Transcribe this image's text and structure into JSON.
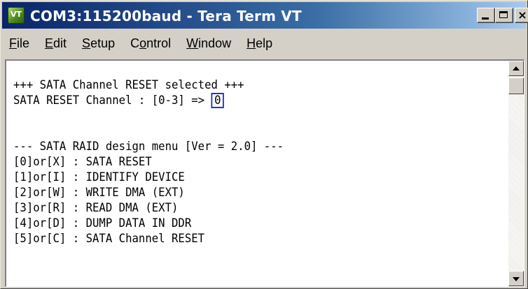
{
  "window": {
    "title": "COM3:115200baud - Tera Term VT",
    "app_icon_label": "VT",
    "icons": {
      "app": "tera-term-icon",
      "minimize": "minimize-icon",
      "maximize": "maximize-icon",
      "close": "close-icon"
    },
    "close_glyph": "×"
  },
  "menu": [
    {
      "mnemonic": "F",
      "rest": "ile"
    },
    {
      "mnemonic": "E",
      "rest": "dit"
    },
    {
      "mnemonic": "S",
      "rest": "etup"
    },
    {
      "prefix": "C",
      "mnemonic": "o",
      "rest": "ntrol"
    },
    {
      "mnemonic": "W",
      "rest": "indow"
    },
    {
      "mnemonic": "H",
      "rest": "elp"
    }
  ],
  "terminal": {
    "line_selected": "+++ SATA Channel RESET selected +++",
    "prompt_text": "SATA RESET Channel : [0-3] => ",
    "prompt_input": "0",
    "menu_header": "--- SATA RAID design menu [Ver = 2.0] ---",
    "options": [
      "[0]or[X] : SATA RESET",
      "[1]or[I] : IDENTIFY DEVICE",
      "[2]or[W] : WRITE DMA (EXT)",
      "[3]or[R] : READ DMA (EXT)",
      "[4]or[D] : DUMP DATA IN DDR",
      "[5]or[C] : SATA Channel RESET"
    ],
    "highlight_color": "#1a34d9"
  }
}
